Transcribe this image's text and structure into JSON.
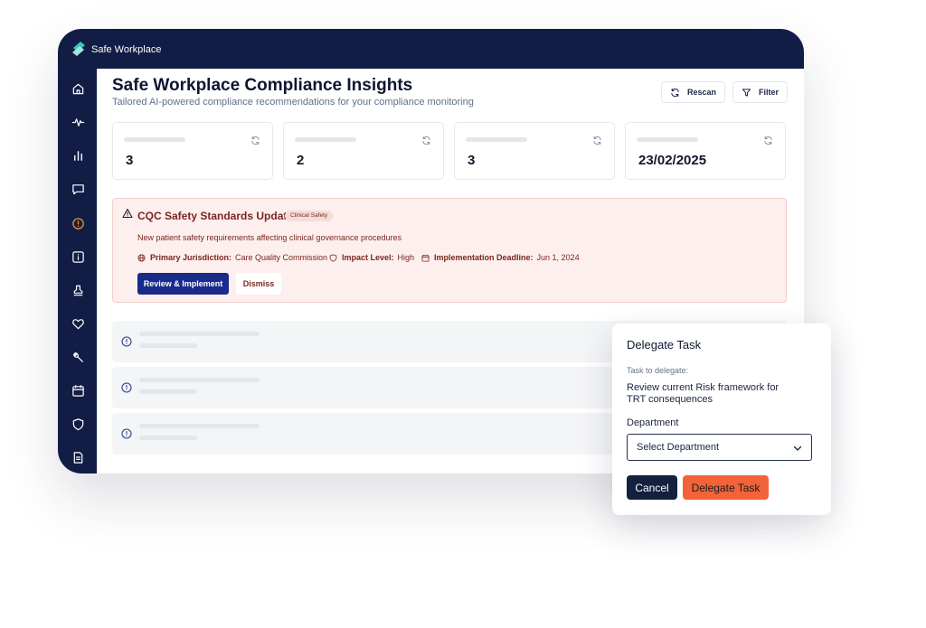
{
  "app": {
    "name": "Safe Workplace"
  },
  "sidebar": {
    "icons": [
      "home-icon",
      "activity-icon",
      "bar-chart-icon",
      "message-icon",
      "alert-circle-icon",
      "info-icon",
      "stamp-icon",
      "heart-icon",
      "wrench-icon",
      "calendar-icon",
      "shield-icon",
      "document-icon"
    ],
    "active_index": 4,
    "active_color": "#f08a3c"
  },
  "header": {
    "title": "Safe Workplace Compliance Insights",
    "subtitle": "Tailored AI-powered compliance recommendations for your compliance monitoring",
    "rescan_label": "Rescan",
    "filter_label": "Filter"
  },
  "stats": [
    {
      "value": "3"
    },
    {
      "value": "2"
    },
    {
      "value": "3"
    },
    {
      "value": "23/02/2025"
    }
  ],
  "alert": {
    "title": "CQC Safety Standards Update",
    "tag": "Clinical Safety",
    "description": "New patient safety requirements affecting clinical governance procedures",
    "jurisdiction_key": "Primary Jurisdiction:",
    "jurisdiction_value": "Care Quality Commission",
    "impact_key": "Impact Level:",
    "impact_value": "High",
    "deadline_key": "Implementation Deadline:",
    "deadline_value": "Jun 1, 2024",
    "primary_label": "Review & Implement",
    "dismiss_label": "Dismiss"
  },
  "modal": {
    "title": "Delegate Task",
    "task_label": "Task to delegate:",
    "task_text": "Review current Risk framework for TRT consequences",
    "department_label": "Department",
    "select_value": "Select Department",
    "cancel_label": "Cancel",
    "delegate_label": "Delegate Task"
  },
  "colors": {
    "navy": "#111d45",
    "primary_button": "#1a2a8a",
    "alert_bg": "#fcefed",
    "alert_text": "#7a2620",
    "delegate_button": "#f2633a"
  }
}
